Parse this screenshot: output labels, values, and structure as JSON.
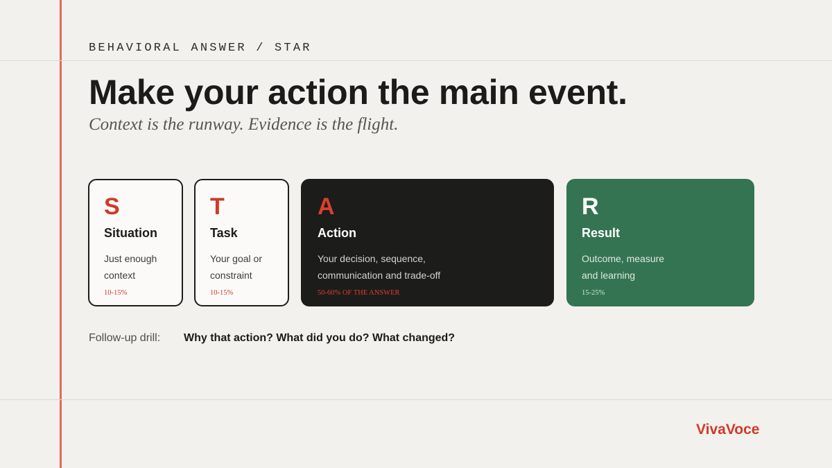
{
  "header": {
    "eyebrow": "BEHAVIORAL ANSWER / STAR",
    "title": "Make your action the main event.",
    "subtitle": "Context is the runway. Evidence is the flight."
  },
  "cards": [
    {
      "letter": "S",
      "name": "Situation",
      "desc": "Just enough context",
      "pct": "10-15%"
    },
    {
      "letter": "T",
      "name": "Task",
      "desc": "Your goal or constraint",
      "pct": "10-15%"
    },
    {
      "letter": "A",
      "name": "Action",
      "desc": "Your decision, sequence, communication and trade-off",
      "pct": "50-60% OF THE ANSWER"
    },
    {
      "letter": "R",
      "name": "Result",
      "desc": "Outcome, measure and learning",
      "pct": "15-25%"
    }
  ],
  "followup": {
    "label": "Follow-up drill:",
    "text": "Why that action? What did you do? What changed?"
  },
  "brand": "VivaVoce",
  "colors": {
    "background": "#f3f1ed",
    "accent_red": "#cf3a2a",
    "rule_red": "#e06a5a",
    "action_dark": "#1c1c1a",
    "result_green": "#347452"
  }
}
